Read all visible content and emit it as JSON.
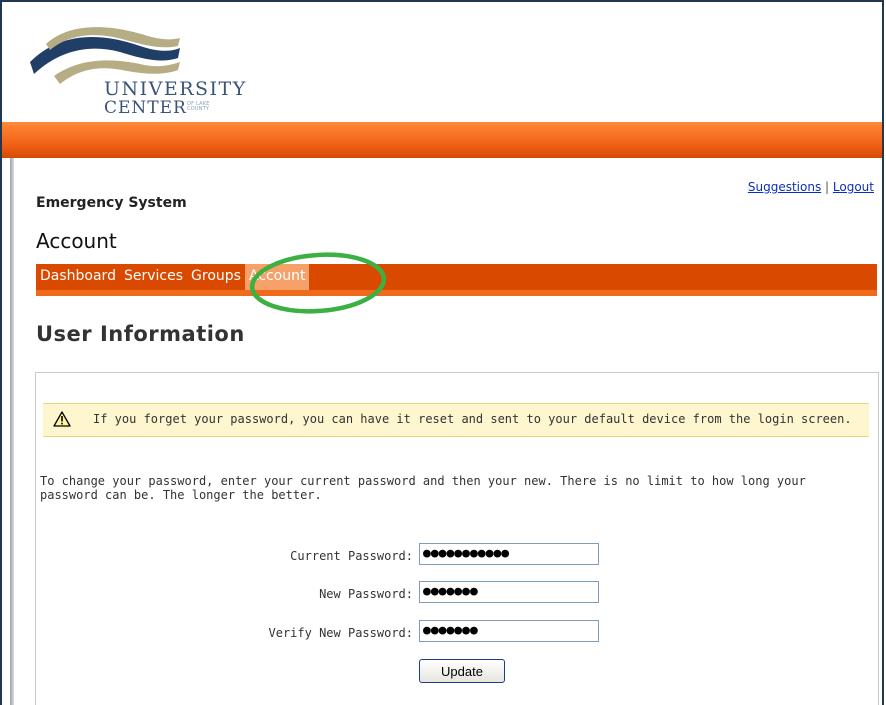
{
  "logo": {
    "line1": "UNIVERSITY",
    "line2": "CENTER",
    "small": "OF LAKE COUNTY"
  },
  "top_links": {
    "suggestions": "Suggestions",
    "separator": "|",
    "logout": "Logout"
  },
  "system_title": "Emergency System",
  "section_title": "Account",
  "nav": {
    "items": [
      {
        "label": "Dashboard"
      },
      {
        "label": "Services"
      },
      {
        "label": "Groups"
      },
      {
        "label": "Account"
      }
    ],
    "active": "Account"
  },
  "page_heading": "User Information",
  "warning": {
    "icon": "warning-triangle-icon",
    "text": "If you forget your password, you can have it reset and sent to your default device from the login screen."
  },
  "instructions": "To change your password, enter your current password and then your new. There is no limit to how long your password can be. The longer the better.",
  "form": {
    "current_password": {
      "label": "Current Password:",
      "masked_value": "●●●●●●●●●●●"
    },
    "new_password": {
      "label": "New Password:",
      "masked_value": "●●●●●●●"
    },
    "verify_password": {
      "label": "Verify New Password:",
      "masked_value": "●●●●●●●"
    },
    "submit_label": "Update"
  },
  "colors": {
    "nav_bar": "#d94a00",
    "active_tab": "#f7a16a",
    "highlight_ring": "#3cb043",
    "link": "#0a2fbf"
  }
}
